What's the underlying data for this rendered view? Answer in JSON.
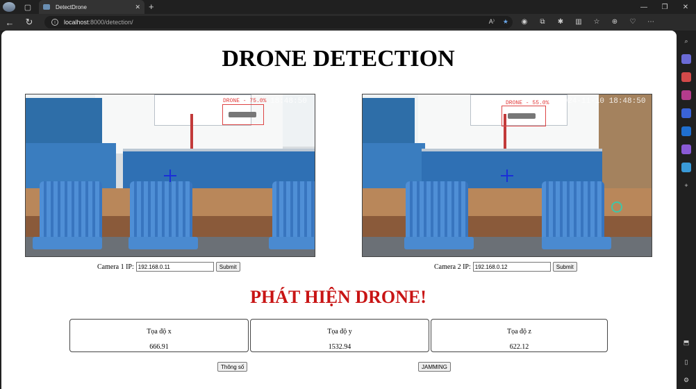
{
  "browser": {
    "tab_title": "DetectDrone",
    "url_host": "localhost",
    "url_path": ":8000/detection/"
  },
  "page": {
    "title": "DRONE DETECTION",
    "alert": "PHÁT HIỆN DRONE!"
  },
  "cameras": [
    {
      "overlay_label": "DRONE - 75.0%",
      "timestamp": "18:48:50",
      "ip_label": "Camera 1 IP:",
      "ip_value": "192.168.0.11",
      "submit_label": "Submit"
    },
    {
      "overlay_label": "DRONE - 55.0%",
      "timestamp": "2024-11-10  18:48:50",
      "ip_label": "Camera 2 IP:",
      "ip_value": "192.168.0.12",
      "submit_label": "Submit"
    }
  ],
  "coordinates": [
    {
      "label": "Tọa độ x",
      "value": "666.91"
    },
    {
      "label": "Tọa độ y",
      "value": "1532.94"
    },
    {
      "label": "Tọa độ z",
      "value": "622.12"
    }
  ],
  "buttons": {
    "params": "Thông số",
    "jamming": "JAMMING"
  }
}
